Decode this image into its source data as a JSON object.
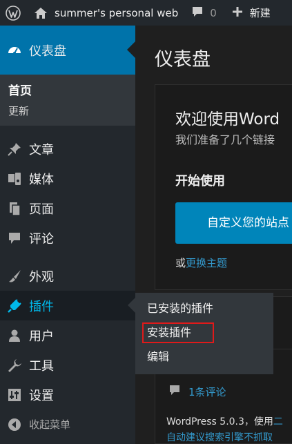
{
  "admin_bar": {
    "site_name": "summer's personal web",
    "comments_count": "0",
    "new_label": "新建"
  },
  "sidebar": {
    "dashboard": {
      "label": "仪表盘",
      "submenu": [
        "首页",
        "更新"
      ]
    },
    "items": [
      {
        "label": "文章",
        "icon": "pushpin-icon"
      },
      {
        "label": "媒体",
        "icon": "media-icon"
      },
      {
        "label": "页面",
        "icon": "page-icon"
      },
      {
        "label": "评论",
        "icon": "comment-icon"
      },
      {
        "label": "外观",
        "icon": "paintbrush-icon"
      },
      {
        "label": "插件",
        "icon": "plugin-icon"
      },
      {
        "label": "用户",
        "icon": "user-icon"
      },
      {
        "label": "工具",
        "icon": "wrench-icon"
      },
      {
        "label": "设置",
        "icon": "settings-icon"
      }
    ],
    "collapse_label": "收起菜单"
  },
  "plugins_flyout": {
    "items": [
      "已安装的插件",
      "安装插件",
      "编辑"
    ]
  },
  "main": {
    "title": "仪表盘",
    "welcome": {
      "heading": "欢迎使用Word",
      "about": "我们准备了几个链接",
      "get_started": "开始使用",
      "customize_button": "自定义您的站点",
      "or_text": "或",
      "change_theme_link": "更换主题"
    },
    "glance": {
      "comments_link": "1条评论",
      "version_text": "WordPress 5.0.3，使用",
      "theme_link": "二",
      "seo_warning": "自动建议搜索引擎不抓取"
    }
  },
  "colors": {
    "accent": "#0073aa",
    "adminbar": "#23282d",
    "highlight_box": "#e01a1a",
    "link": "#3399cc"
  }
}
